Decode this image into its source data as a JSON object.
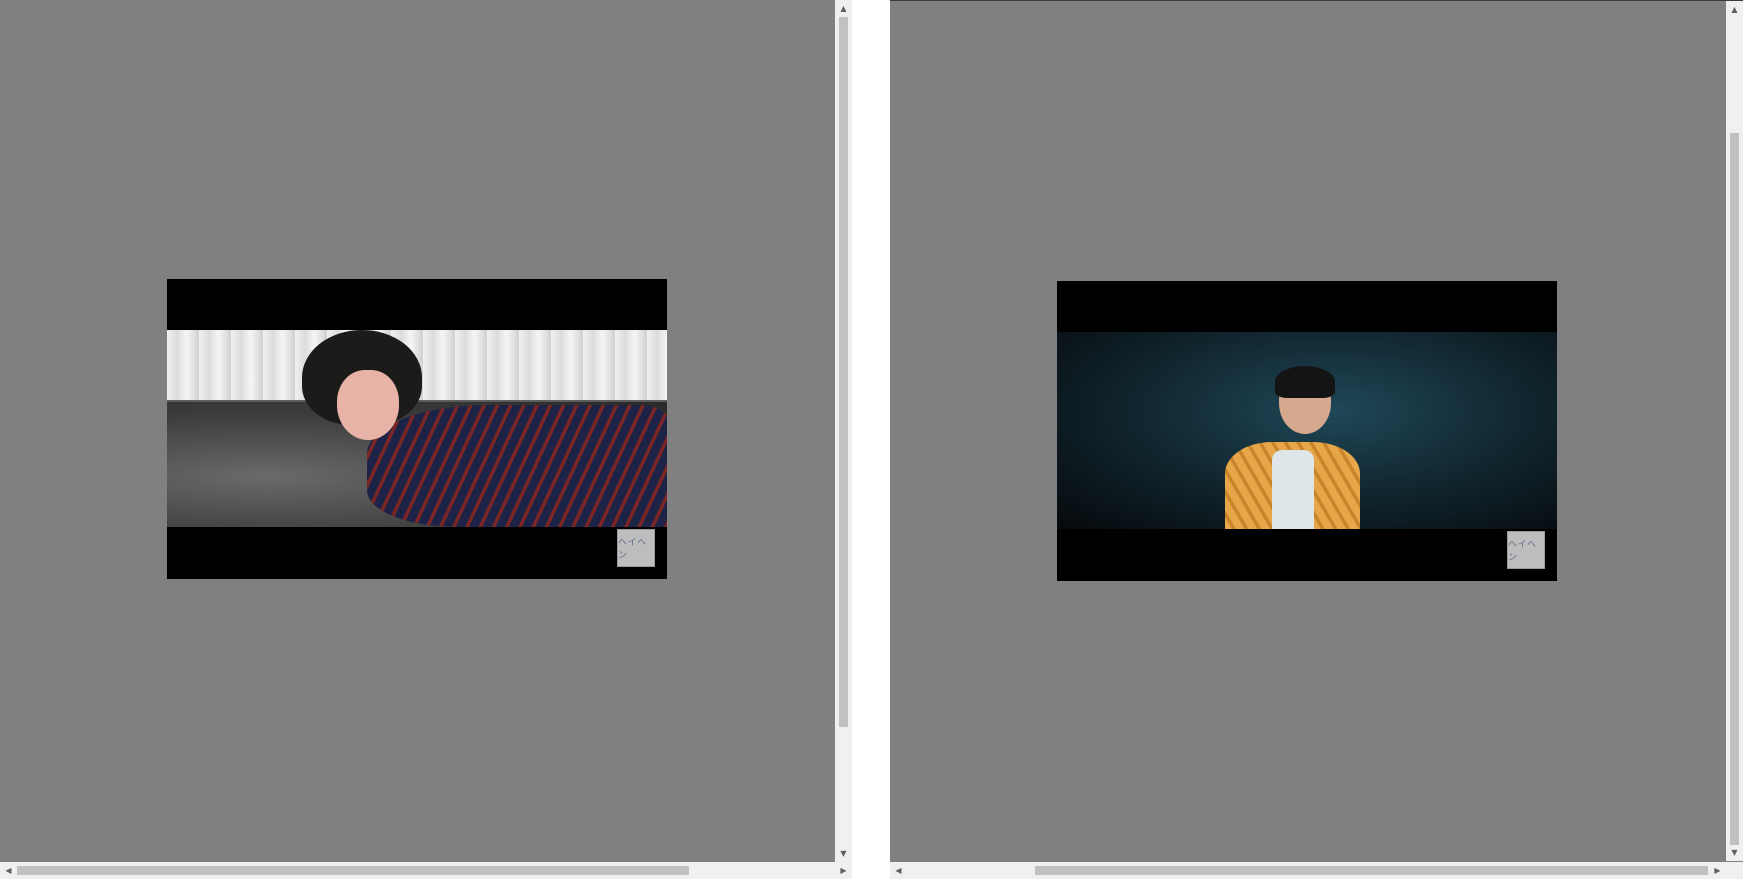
{
  "panes": [
    {
      "video": {
        "watermark_text": "ヘイヘン"
      }
    },
    {
      "video": {
        "watermark_text": "ヘイヘン"
      }
    }
  ],
  "icons": {
    "scroll_up": "▲",
    "scroll_down": "▼",
    "scroll_left": "◀",
    "scroll_right": "▶"
  },
  "colors": {
    "page_background": "#808080",
    "video_background": "#000000",
    "scrollbar_track": "#f0f0f0",
    "scrollbar_thumb": "#c1c1c1"
  },
  "scroll_state": {
    "left_pane": {
      "vertical_thumb_fraction": 0.84,
      "horizontal_thumb_fraction": 0.82
    },
    "right_pane": {
      "vertical_thumb_fraction": 0.85,
      "horizontal_thumb_fraction": 0.82
    }
  }
}
